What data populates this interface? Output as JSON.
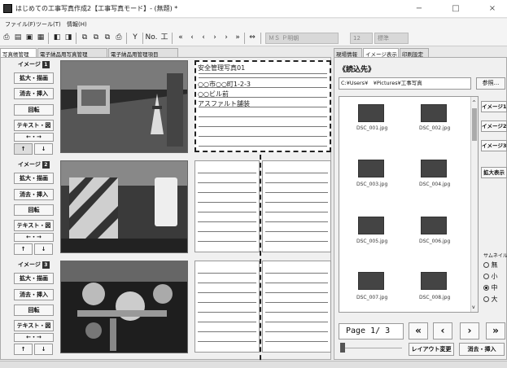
{
  "window": {
    "title": "はじめての工事写真作成2【工事写真モード】- (無題) *",
    "minimize": "−",
    "maximize": "□",
    "close": "×"
  },
  "menu": [
    "ファイル(F)",
    "ツール(T)",
    "情報(H)"
  ],
  "toolbar": {
    "font": "ＭＳ Ｐ明朝",
    "size": "12",
    "style": "標準",
    "accent": "#555555"
  },
  "tabs_left": [
    "写真帳管理",
    "電子納品用写真管理",
    "電子納品用管理項目"
  ],
  "tabs_right": [
    "現場情報",
    "イメージ表示",
    "印刷設定"
  ],
  "images": [
    {
      "label": "イメージ",
      "num": "1",
      "notes": [
        "安全管理写真01",
        "○○市○○町1-2-3",
        "○○ビル前",
        "アスファルト舗装"
      ]
    },
    {
      "label": "イメージ",
      "num": "2",
      "notes": []
    },
    {
      "label": "イメージ",
      "num": "3",
      "notes": []
    }
  ],
  "side_buttons": {
    "zoom": "拡大・描画",
    "erase": "消去・挿入",
    "rotate": "回転",
    "text": "テキスト・図",
    "arrow_lr": "←・→",
    "up": "↑",
    "down": "↓"
  },
  "right": {
    "title": "《読込先》",
    "path": "C:¥Users¥　¥Pictures¥工事写真",
    "browse": "参照...",
    "thumbs": [
      "DSC_001.jpg",
      "DSC_002.jpg",
      "DSC_003.jpg",
      "DSC_004.jpg",
      "DSC_005.jpg",
      "DSC_006.jpg",
      "DSC_007.jpg",
      "DSC_008.jpg"
    ],
    "image_buttons": [
      "イメージ1",
      "イメージ2",
      "イメージ3"
    ],
    "enlarge": "拡大表示",
    "thumb_size_label": "サムネイル",
    "sizes": [
      "無",
      "小",
      "中",
      "大"
    ],
    "selected_size": "中",
    "page": "Page 1/ 3",
    "layout_change": "レイアウト変更",
    "erase_insert": "消去・挿入"
  }
}
